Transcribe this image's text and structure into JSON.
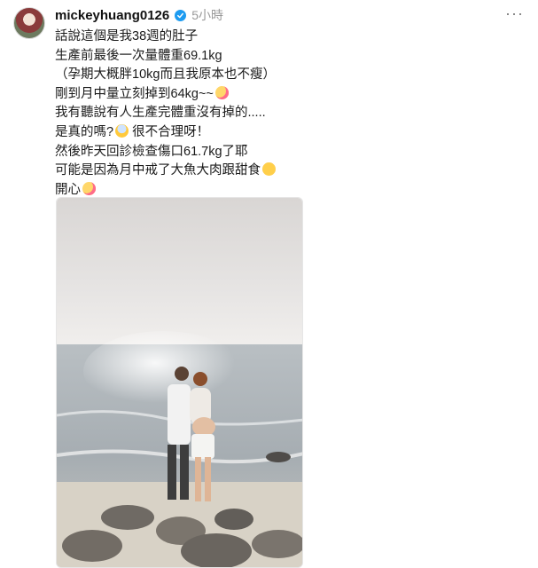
{
  "post": {
    "username": "mickeyhuang0126",
    "time": "5小時",
    "more_icon": "more-horizontal-icon",
    "caption_lines": [
      {
        "text": "話說這個是我38週的肚子",
        "emoji": null
      },
      {
        "text": "生產前最後一次量體重69.1kg",
        "emoji": null
      },
      {
        "text": "（孕期大概胖10kg而且我原本也不瘦）",
        "emoji": null
      },
      {
        "text": "剛到月中量立刻掉到64kg~~",
        "emoji": "smiling-face-with-hearts"
      },
      {
        "text": "我有聽說有人生產完體重沒有掉的.....",
        "emoji": null
      },
      {
        "text": "是真的嗎?",
        "emoji": "face-screaming"
      },
      {
        "text": "很不合理呀！",
        "emoji": null
      },
      {
        "text": "然後昨天回診檢查傷口61.7kg了耶",
        "emoji": null
      },
      {
        "text": "可能是因為月中戒了大魚大肉跟甜食",
        "emoji": "face-savoring-food"
      },
      {
        "text": "開心",
        "emoji": "smiling-face-with-hearts"
      }
    ]
  }
}
